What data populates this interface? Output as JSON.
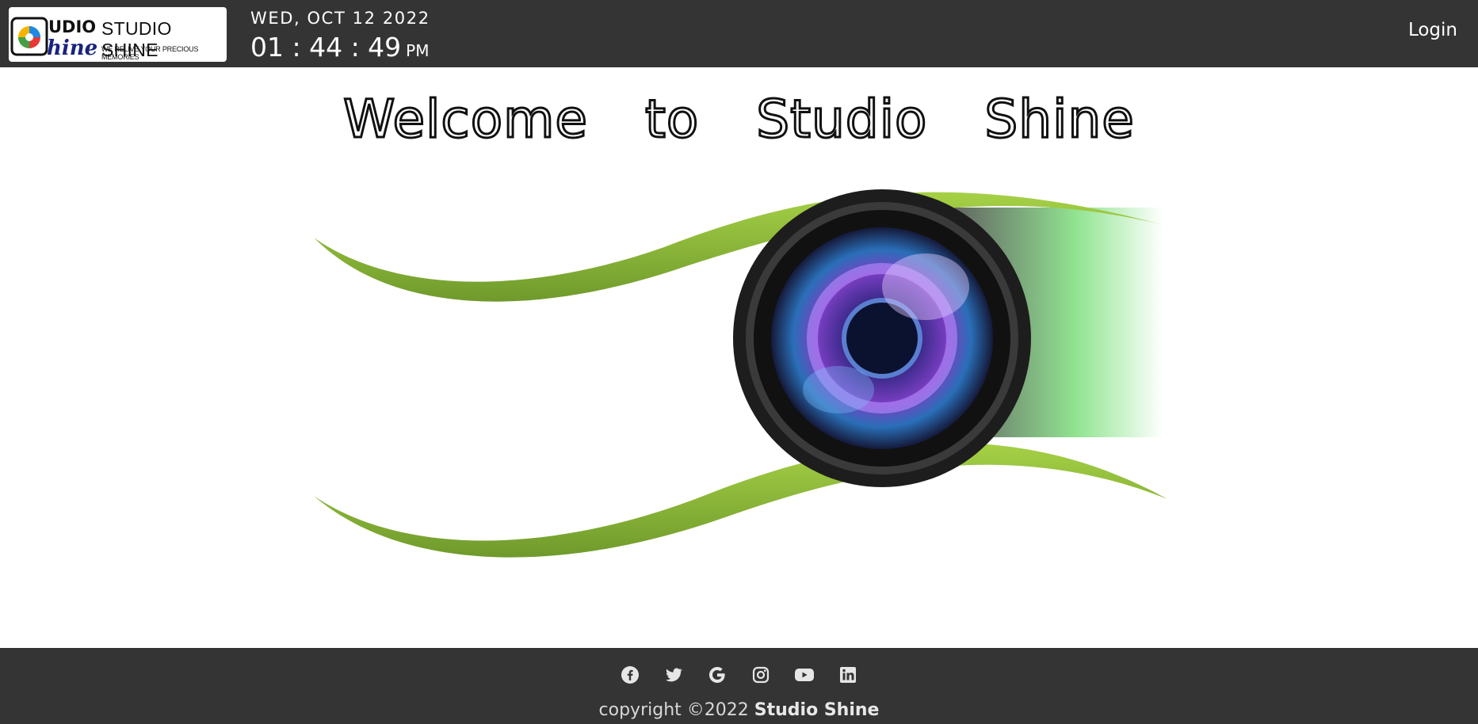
{
  "header": {
    "logo_text": "STUDIO SHINE",
    "logo_tagline": "WE RELIVE YOUR PRECIOUS MEMORIES",
    "logo_mark_text": "Studio Shine",
    "date": "WED, OCT 12 2022",
    "time": "01 : 44 : 49",
    "ampm": "PM",
    "login_label": "Login"
  },
  "main": {
    "welcome": "Welcome to Studio Shine"
  },
  "footer": {
    "social": [
      "facebook-icon",
      "twitter-icon",
      "google-icon",
      "instagram-icon",
      "youtube-icon",
      "linkedin-icon"
    ],
    "copyright_prefix": "copyright ©2022",
    "copyright_brand": "Studio Shine"
  },
  "colors": {
    "bar": "#343434",
    "accent_green": "#9ac43c"
  }
}
